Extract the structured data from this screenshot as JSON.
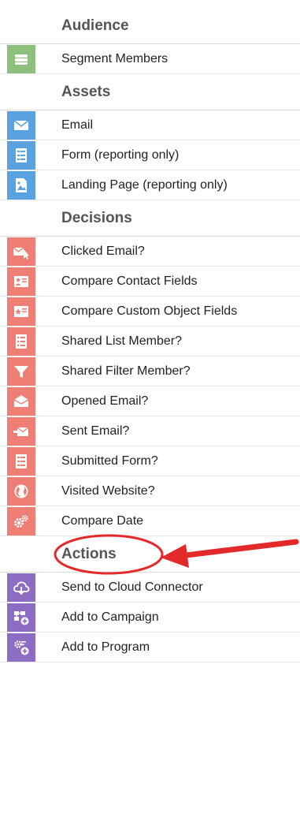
{
  "colors": {
    "audience": "#8dc07c",
    "assets": "#5aa1e0",
    "decisions": "#ef7f74",
    "actions": "#8d6cc4",
    "annotation": "#e32a2a"
  },
  "sections": {
    "audience": {
      "title": "Audience",
      "items": [
        {
          "label": "Segment Members",
          "icon": "segment-members-icon"
        }
      ]
    },
    "assets": {
      "title": "Assets",
      "items": [
        {
          "label": "Email",
          "icon": "email-icon"
        },
        {
          "label": "Form (reporting only)",
          "icon": "form-icon"
        },
        {
          "label": "Landing Page (reporting only)",
          "icon": "landing-page-icon"
        }
      ]
    },
    "decisions": {
      "title": "Decisions",
      "items": [
        {
          "label": "Clicked Email?",
          "icon": "clicked-email-icon"
        },
        {
          "label": "Compare Contact Fields",
          "icon": "contact-card-icon"
        },
        {
          "label": "Compare Custom Object Fields",
          "icon": "custom-object-card-icon"
        },
        {
          "label": "Shared List Member?",
          "icon": "list-icon"
        },
        {
          "label": "Shared Filter Member?",
          "icon": "filter-icon"
        },
        {
          "label": "Opened Email?",
          "icon": "opened-email-icon"
        },
        {
          "label": "Sent Email?",
          "icon": "sent-email-icon"
        },
        {
          "label": "Submitted Form?",
          "icon": "submitted-form-icon"
        },
        {
          "label": "Visited Website?",
          "icon": "globe-icon"
        },
        {
          "label": "Compare Date",
          "icon": "gears-icon"
        }
      ]
    },
    "actions": {
      "title": "Actions",
      "items": [
        {
          "label": "Send to Cloud Connector",
          "icon": "cloud-icon"
        },
        {
          "label": "Add to Campaign",
          "icon": "add-to-campaign-icon"
        },
        {
          "label": "Add to Program",
          "icon": "add-to-program-icon"
        }
      ]
    }
  }
}
